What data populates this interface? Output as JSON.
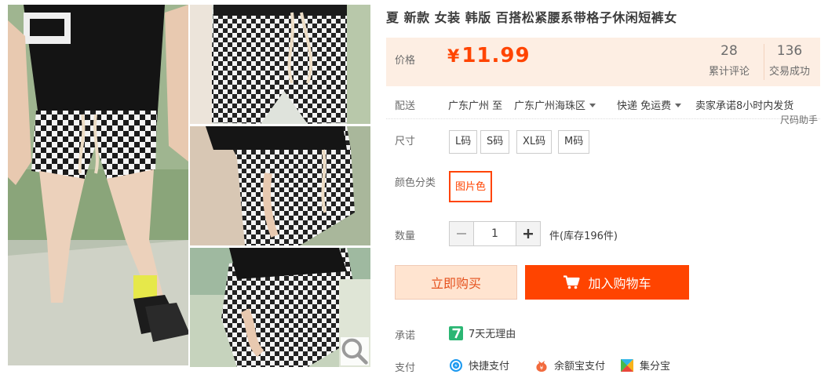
{
  "product": {
    "title": "夏 新款 女装 韩版 百搭松紧腰系带格子休闲短裤女"
  },
  "price": {
    "label": "价格",
    "currency": "¥",
    "amount": "11.99",
    "color": "#ff4400"
  },
  "stats": {
    "comments_count": "28",
    "comments_label": "累计评论",
    "deals_count": "136",
    "deals_label": "交易成功"
  },
  "delivery": {
    "label": "配送",
    "from": "广东广州 至",
    "to": "广东广州海珠区",
    "shipping": "快递 免运费",
    "promise": "卖家承诺8小时内发货"
  },
  "size_helper": "尺码助手",
  "sizes": {
    "label": "尺寸",
    "options": [
      "L码",
      "S码",
      "XL码",
      "M码"
    ]
  },
  "colors": {
    "label": "颜色分类",
    "selected": "图片色"
  },
  "quantity": {
    "label": "数量",
    "value": "1",
    "stock": "件(库存196件)"
  },
  "actions": {
    "buy_now": "立即购买",
    "add_to_cart": "加入购物车",
    "accent": "#ff4400"
  },
  "services": {
    "promise_label": "承诺",
    "promise_item": "7天无理由",
    "pay_label": "支付",
    "pay_methods": [
      "快捷支付",
      "余额宝支付",
      "集分宝"
    ]
  },
  "icons": {
    "zoom": "magnifier-icon",
    "cart": "cart-icon",
    "seven_days": "seven-days-icon",
    "quick_pay": "quick-pay-icon",
    "yuebao": "yuebao-icon",
    "jifenbao": "jifenbao-icon"
  }
}
